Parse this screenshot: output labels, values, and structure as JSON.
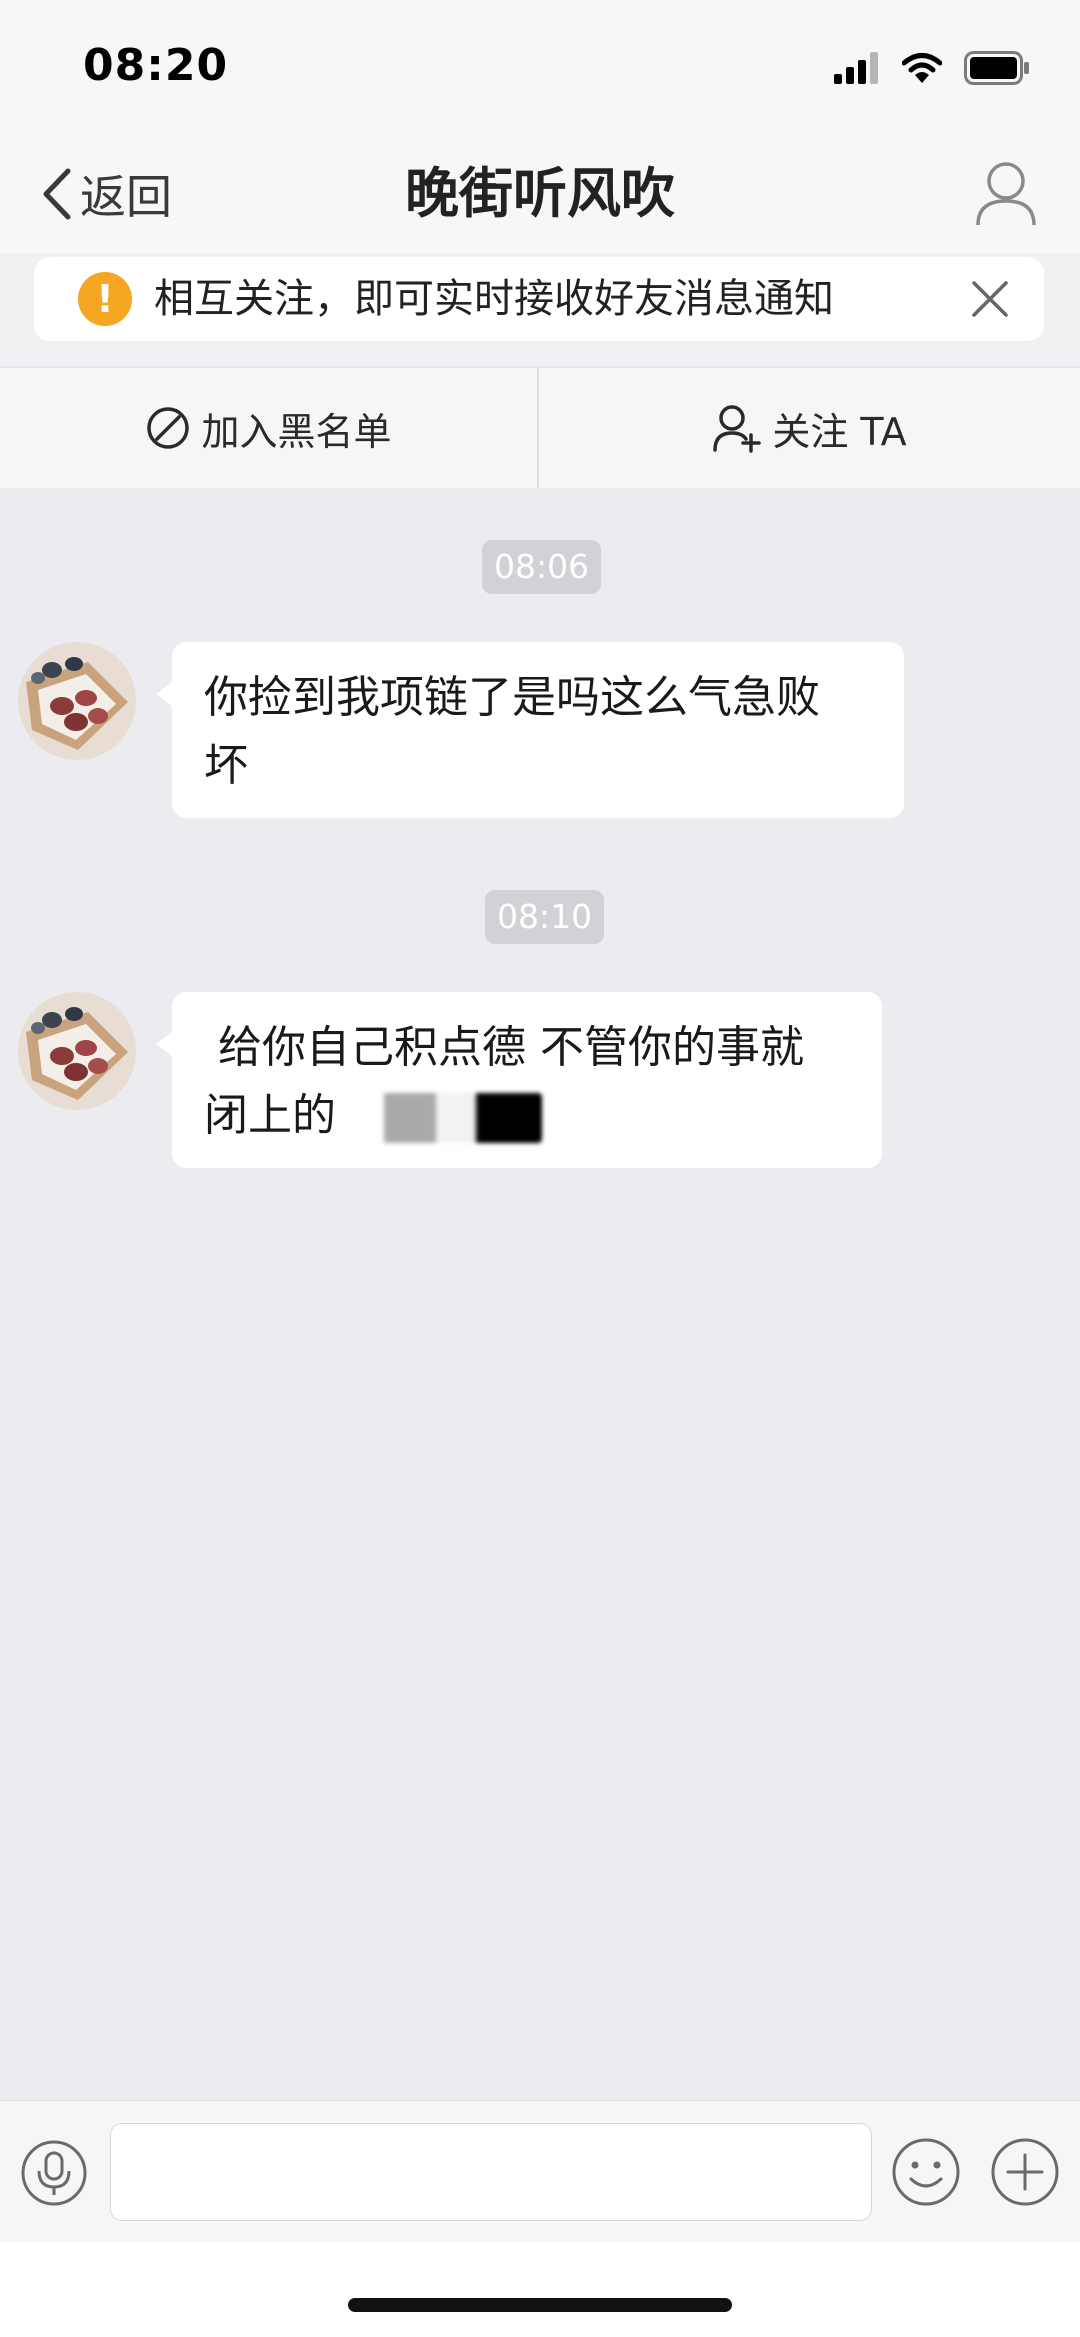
{
  "status_bar": {
    "time": "08:20",
    "icons": [
      "signal-icon",
      "wifi-icon",
      "battery-icon"
    ]
  },
  "nav": {
    "back_label": "返回",
    "title": "晚街听风吹",
    "profile_icon": "person-icon"
  },
  "notice": {
    "text": "相互关注，即可实时接收好友消息通知",
    "icon": "warning-icon",
    "icon_glyph": "!",
    "close_icon": "close-icon"
  },
  "actions": {
    "block_label": "加入黑名单",
    "follow_label": "关注 TA"
  },
  "messages": [
    {
      "time": "08:06",
      "sender": "other",
      "line1": "你捡到我项链了是吗这么气急败",
      "line2": "坏"
    },
    {
      "time": "08:10",
      "sender": "other",
      "line1": " 给你自己积点德 不管你的事就",
      "line2": "闭上的"
    }
  ],
  "input": {
    "placeholder": "",
    "value": ""
  },
  "colors": {
    "warning": "#f5a623",
    "chat_background": "#ebebf0",
    "timestamp_bg": "#d2d2d6",
    "bubble": "#ffffff"
  }
}
